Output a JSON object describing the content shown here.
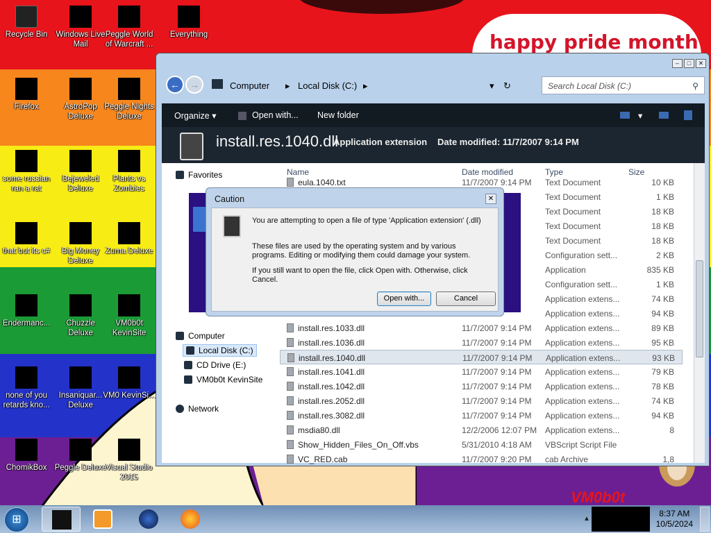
{
  "wallpaper": {
    "text": "happy pride month",
    "signature": "VM0b0t"
  },
  "desktop_icons": [
    {
      "label": "Recycle Bin",
      "icon": "recycle-bin-icon"
    },
    {
      "label": "Windows Live Mail",
      "icon": "mail-icon"
    },
    {
      "label": "Peggle World of Warcraft ...",
      "icon": "game-icon"
    },
    {
      "label": "Everything",
      "icon": "search-app-icon"
    },
    {
      "label": "Firefox",
      "icon": "firefox-icon"
    },
    {
      "label": "AstroPop Deluxe",
      "icon": "game-icon"
    },
    {
      "label": "Peggle Nights Deluxe",
      "icon": "game-icon"
    },
    {
      "label": "some russian ran a rat",
      "icon": "app-icon"
    },
    {
      "label": "Bejeweled Deluxe",
      "icon": "game-icon"
    },
    {
      "label": "Plants vs Zombies",
      "icon": "game-icon"
    },
    {
      "label": "that but its c#",
      "icon": "app-icon"
    },
    {
      "label": "Big Money Deluxe",
      "icon": "game-icon"
    },
    {
      "label": "Zuma Deluxe",
      "icon": "game-icon"
    },
    {
      "label": "Endermanc...",
      "icon": "app-icon"
    },
    {
      "label": "Chuzzle Deluxe",
      "icon": "game-icon"
    },
    {
      "label": "VM0b0t KevinSite",
      "icon": "shortcut-icon"
    },
    {
      "label": "none of you retards kno...",
      "icon": "app-icon"
    },
    {
      "label": "Insaniquar... Deluxe",
      "icon": "game-icon"
    },
    {
      "label": "VM0 KevinSi...",
      "icon": "shortcut-icon"
    },
    {
      "label": "ChomikBox",
      "icon": "app-icon"
    },
    {
      "label": "Peggle Deluxe",
      "icon": "game-icon"
    },
    {
      "label": "Visual Studio 2015",
      "icon": "visual-studio-icon"
    }
  ],
  "explorer": {
    "address": {
      "crumb1": "Computer",
      "crumb2": "Local Disk (C:)"
    },
    "search_placeholder": "Search Local Disk (C:)",
    "toolbar": {
      "organize": "Organize",
      "open_with": "Open with...",
      "new_folder": "New folder"
    },
    "details": {
      "filename": "install.res.1040.dll",
      "type": "Application extension",
      "modified_label": "Date modified:",
      "modified_value": "11/7/2007 9:14 PM"
    },
    "nav": {
      "favorites": "Favorites",
      "computer": "Computer",
      "local_disk": "Local Disk (C:)",
      "cd_drive": "CD Drive (E:)",
      "vm": "VM0b0t KevinSite",
      "network": "Network"
    },
    "columns": {
      "name": "Name",
      "date": "Date modified",
      "type": "Type",
      "size": "Size"
    },
    "files": [
      {
        "name": "eula.1040.txt",
        "date": "11/7/2007 9:14 PM",
        "type": "Text Document",
        "size": "10 KB"
      },
      {
        "name": "",
        "date": "PM",
        "type": "Text Document",
        "size": "1 KB"
      },
      {
        "name": "",
        "date": "PM",
        "type": "Text Document",
        "size": "18 KB"
      },
      {
        "name": "",
        "date": "PM",
        "type": "Text Document",
        "size": "18 KB"
      },
      {
        "name": "",
        "date": "PM",
        "type": "Text Document",
        "size": "18 KB"
      },
      {
        "name": "",
        "date": "PM",
        "type": "Configuration sett...",
        "size": "2 KB"
      },
      {
        "name": "",
        "date": "PM",
        "type": "Application",
        "size": "835 KB"
      },
      {
        "name": "",
        "date": "PM",
        "type": "Configuration sett...",
        "size": "1 KB"
      },
      {
        "name": "",
        "date": "PM",
        "type": "Application extens...",
        "size": "74 KB"
      },
      {
        "name": "",
        "date": "PM",
        "type": "Application extens...",
        "size": "94 KB"
      },
      {
        "name": "install.res.1033.dll",
        "date": "11/7/2007 9:14 PM",
        "type": "Application extens...",
        "size": "89 KB"
      },
      {
        "name": "install.res.1036.dll",
        "date": "11/7/2007 9:14 PM",
        "type": "Application extens...",
        "size": "95 KB"
      },
      {
        "name": "install.res.1040.dll",
        "date": "11/7/2007 9:14 PM",
        "type": "Application extens...",
        "size": "93 KB"
      },
      {
        "name": "install.res.1041.dll",
        "date": "11/7/2007 9:14 PM",
        "type": "Application extens...",
        "size": "79 KB"
      },
      {
        "name": "install.res.1042.dll",
        "date": "11/7/2007 9:14 PM",
        "type": "Application extens...",
        "size": "78 KB"
      },
      {
        "name": "install.res.2052.dll",
        "date": "11/7/2007 9:14 PM",
        "type": "Application extens...",
        "size": "74 KB"
      },
      {
        "name": "install.res.3082.dll",
        "date": "11/7/2007 9:14 PM",
        "type": "Application extens...",
        "size": "94 KB"
      },
      {
        "name": "msdia80.dll",
        "date": "12/2/2006 12:07 PM",
        "type": "Application extens...",
        "size": "8"
      },
      {
        "name": "Show_Hidden_Files_On_Off.vbs",
        "date": "5/31/2010 4:18 AM",
        "type": "VBScript Script File",
        "size": ""
      },
      {
        "name": "VC_RED.cab",
        "date": "11/7/2007 9:20 PM",
        "type": "cab Archive",
        "size": "1,8"
      }
    ]
  },
  "dialog": {
    "title": "Caution",
    "message": "You are attempting to open a file of type 'Application extension' (.dll)",
    "detail": "These files are used by the operating system and by various programs. Editing or modifying them could damage your system.",
    "instruction": "If you still want to open the file, click Open with. Otherwise, click Cancel.",
    "open_with": "Open with...",
    "cancel": "Cancel"
  },
  "taskbar": {
    "time": "8:37 AM",
    "date": "10/5/2024"
  }
}
